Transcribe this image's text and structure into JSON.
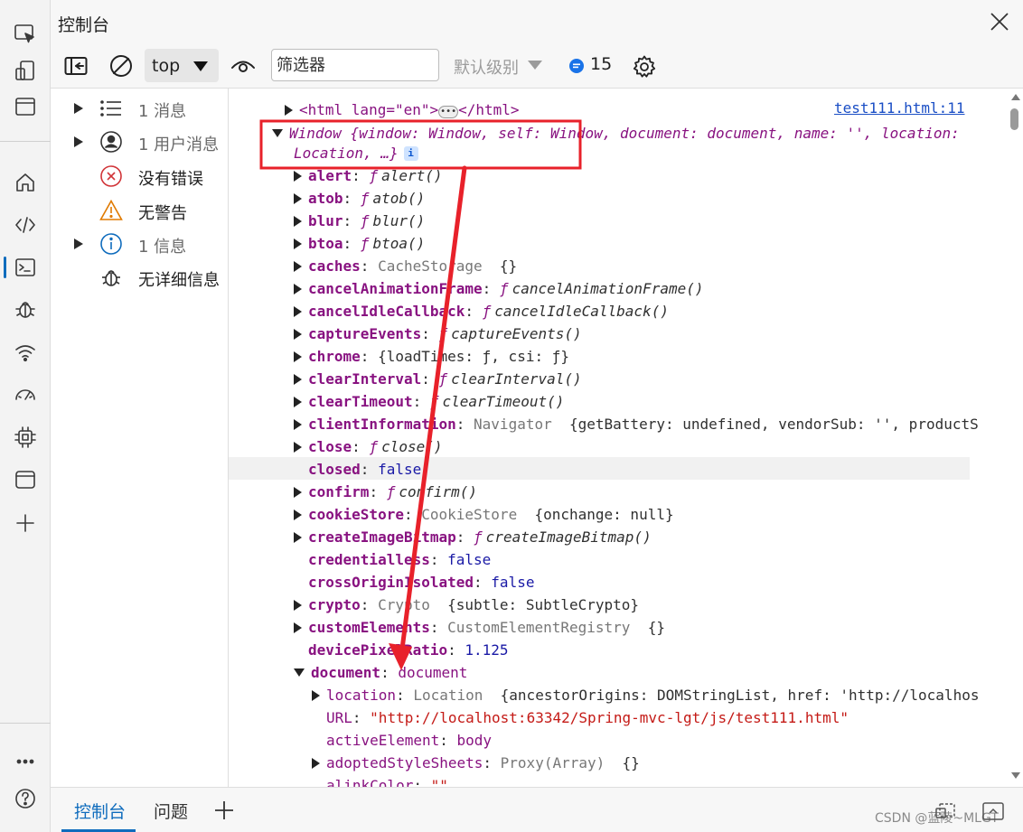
{
  "window": {
    "title": "控制台"
  },
  "toolbar": {
    "context": "top",
    "filter_placeholder": "筛选器",
    "level": "默认级别",
    "message_count": "15"
  },
  "sidebar": {
    "items": [
      {
        "label": "1 消息",
        "icon": "list-icon"
      },
      {
        "label": "1 用户消息",
        "icon": "user-icon"
      },
      {
        "label": "没有错误",
        "icon": "error-icon"
      },
      {
        "label": "无警告",
        "icon": "warning-icon"
      },
      {
        "label": "1 信息",
        "icon": "info-icon"
      },
      {
        "label": "无详细信息",
        "icon": "bug-icon"
      }
    ]
  },
  "console": {
    "source_link": "test111.html:11",
    "html_line": {
      "open": "<html lang=\"en\">",
      "close": "</html>",
      "ellipsis": "•••"
    },
    "window_line": {
      "text1": "Window  {window: Window, self: Window, document: document, name: '', location:",
      "text2": "Location,  …}",
      "badge": "i"
    },
    "props": [
      {
        "name": "alert",
        "kind": "fn",
        "value": "alert()"
      },
      {
        "name": "atob",
        "kind": "fn",
        "value": "atob()"
      },
      {
        "name": "blur",
        "kind": "fn",
        "value": "blur()"
      },
      {
        "name": "btoa",
        "kind": "fn",
        "value": "btoa()"
      },
      {
        "name": "caches",
        "kind": "obj",
        "cls": "CacheStorage",
        "value": "{}"
      },
      {
        "name": "cancelAnimationFrame",
        "kind": "fn",
        "value": "cancelAnimationFrame()"
      },
      {
        "name": "cancelIdleCallback",
        "kind": "fn",
        "value": "cancelIdleCallback()"
      },
      {
        "name": "captureEvents",
        "kind": "fn",
        "value": "captureEvents()"
      },
      {
        "name": "chrome",
        "kind": "obj",
        "cls": "",
        "value": "{loadTimes: ƒ, csi: ƒ}"
      },
      {
        "name": "clearInterval",
        "kind": "fn",
        "value": "clearInterval()"
      },
      {
        "name": "clearTimeout",
        "kind": "fn",
        "value": "clearTimeout()"
      },
      {
        "name": "clientInformation",
        "kind": "obj",
        "cls": "Navigator",
        "value": "{getBattery: undefined, vendorSub: '', productS"
      },
      {
        "name": "close",
        "kind": "fn",
        "value": "close()"
      },
      {
        "name": "closed",
        "kind": "prim",
        "value": "false"
      },
      {
        "name": "confirm",
        "kind": "fn",
        "value": "confirm()"
      },
      {
        "name": "cookieStore",
        "kind": "obj",
        "cls": "CookieStore",
        "value": "{onchange: null}"
      },
      {
        "name": "createImageBitmap",
        "kind": "fn",
        "value": "createImageBitmap()"
      },
      {
        "name": "credentialless",
        "kind": "prim",
        "value": "false"
      },
      {
        "name": "crossOriginIsolated",
        "kind": "prim",
        "value": "false"
      },
      {
        "name": "crypto",
        "kind": "obj",
        "cls": "Crypto",
        "value": "{subtle: SubtleCrypto}"
      },
      {
        "name": "customElements",
        "kind": "obj",
        "cls": "CustomElementRegistry",
        "value": "{}"
      },
      {
        "name": "devicePixelRatio",
        "kind": "prim",
        "value": "1.125"
      },
      {
        "name": "document",
        "kind": "open",
        "value": "document"
      }
    ],
    "doc_children": [
      {
        "name": "location",
        "kind": "obj",
        "cls": "Location",
        "value": "{ancestorOrigins: DOMStringList, href: 'http://localhos"
      },
      {
        "name": "URL",
        "kind": "str",
        "value": "\"http://localhost:63342/Spring-mvc-lgt/js/test111.html\""
      },
      {
        "name": "activeElement",
        "kind": "plain",
        "value": "body"
      },
      {
        "name": "adoptedStyleSheets",
        "kind": "obj",
        "cls": "Proxy(Array)",
        "value": "{}"
      },
      {
        "name": "alinkColor",
        "kind": "str",
        "value": "\"\""
      }
    ]
  },
  "bottom": {
    "tab_console": "控制台",
    "tab_issues": "问题",
    "watermark": "CSDN @蓝陵~MLGT"
  },
  "colors": {
    "accent": "#0f6cbd",
    "annotation_red": "#e8212a",
    "keyword": "#881280"
  }
}
